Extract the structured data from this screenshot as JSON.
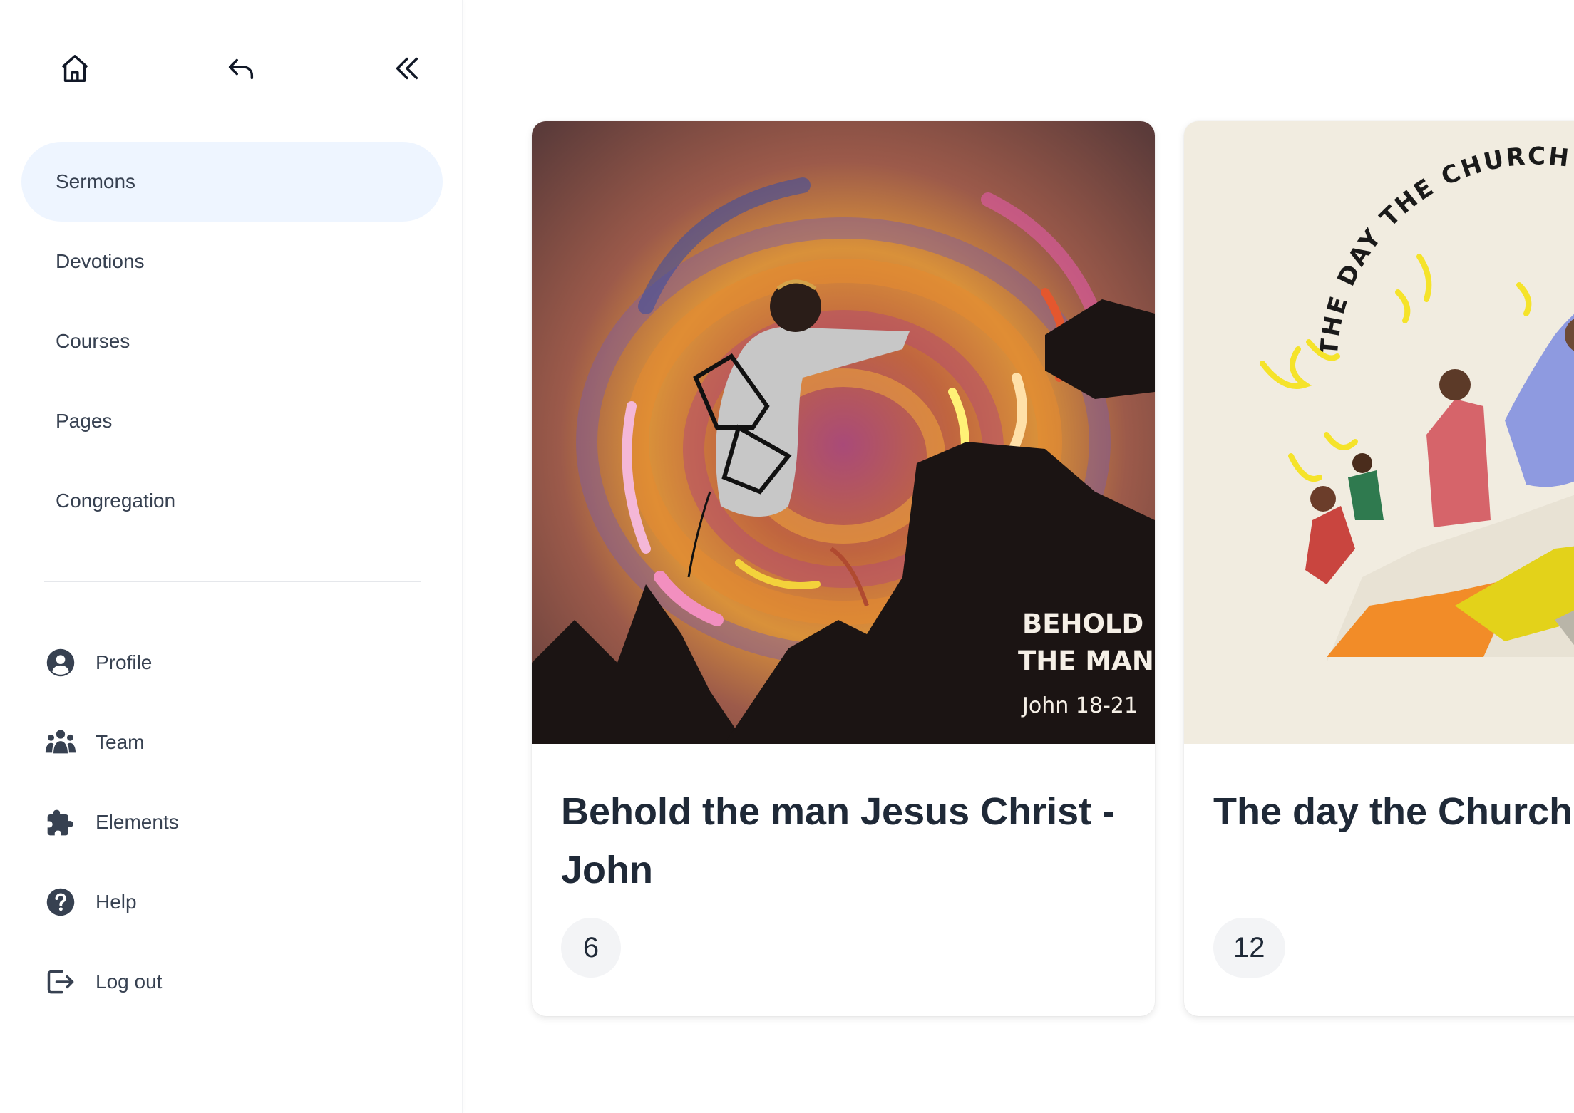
{
  "sidebar": {
    "top_icons": [
      "home-icon",
      "back-arrow-icon",
      "collapse-icon"
    ],
    "nav": [
      {
        "label": "Sermons",
        "active": true
      },
      {
        "label": "Devotions",
        "active": false
      },
      {
        "label": "Courses",
        "active": false
      },
      {
        "label": "Pages",
        "active": false
      },
      {
        "label": "Congregation",
        "active": false
      }
    ],
    "menu": [
      {
        "label": "Profile",
        "icon": "user-circle-icon"
      },
      {
        "label": "Team",
        "icon": "users-icon"
      },
      {
        "label": "Elements",
        "icon": "puzzle-icon"
      },
      {
        "label": "Help",
        "icon": "help-circle-icon"
      },
      {
        "label": "Log out",
        "icon": "logout-icon"
      }
    ]
  },
  "cards": [
    {
      "title": "Behold the man Jesus Christ - John",
      "count": "6",
      "art_lettering": [
        "BEHOLD",
        "THE MAN",
        "John 18-21"
      ]
    },
    {
      "title": "The day the Church Acts",
      "count": "12",
      "art_lettering": "THE DAY THE CHURCH"
    }
  ],
  "colors": {
    "active_nav_bg": "#eef5ff",
    "text_primary": "#1f2937",
    "text_secondary": "#374151",
    "badge_bg": "#f3f4f6"
  }
}
